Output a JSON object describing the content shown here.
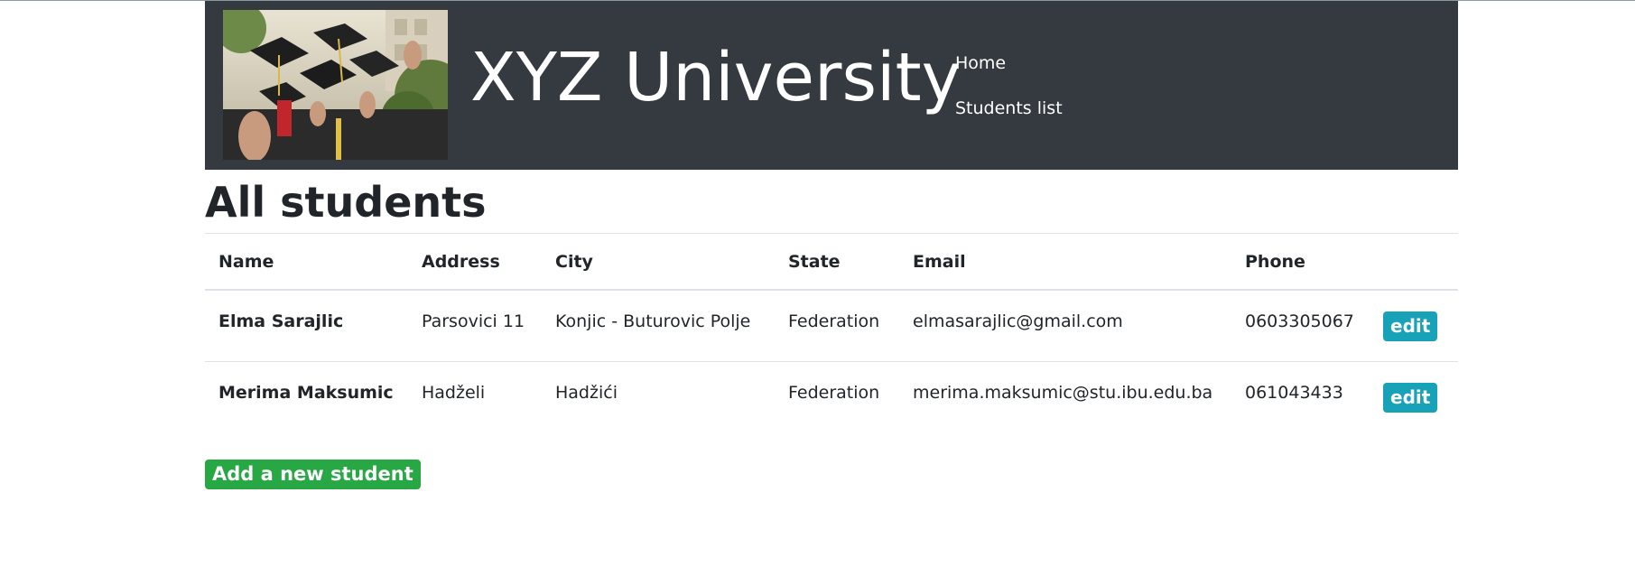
{
  "header": {
    "title": "XYZ University",
    "logo_alt": "graduation caps thrown in the air",
    "nav": [
      {
        "label": "Home"
      },
      {
        "label": "Students list"
      }
    ]
  },
  "main": {
    "page_title": "All students",
    "table": {
      "columns": [
        "Name",
        "Address",
        "City",
        "State",
        "Email",
        "Phone",
        ""
      ],
      "rows": [
        {
          "name": "Elma Sarajlic",
          "address": "Parsovici 11",
          "city": "Konjic - Buturovic Polje",
          "state": "Federation",
          "email": "elmasarajlic@gmail.com",
          "phone": "0603305067",
          "action": "edit"
        },
        {
          "name": "Merima Maksumic",
          "address": "Hadželi",
          "city": "Hadžići",
          "state": "Federation",
          "email": "merima.maksumic@stu.ibu.edu.ba",
          "phone": "061043433",
          "action": "edit"
        }
      ]
    },
    "add_button": "Add a new student"
  },
  "colors": {
    "header_bg": "#343a40",
    "edit_button": "#17a2b8",
    "add_button": "#28a745"
  }
}
